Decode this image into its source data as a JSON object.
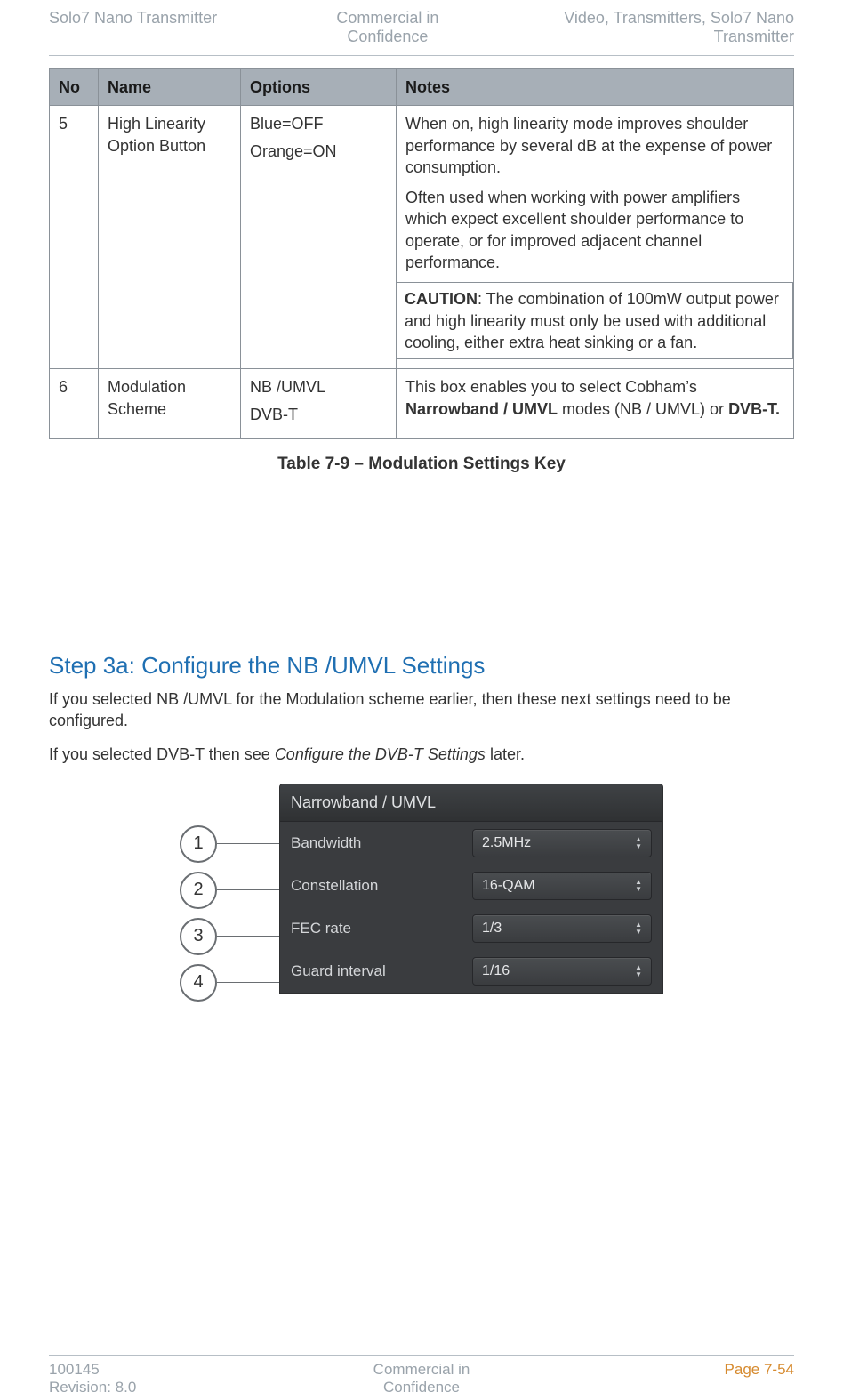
{
  "header": {
    "left": "Solo7 Nano Transmitter",
    "mid_line1": "Commercial in",
    "mid_line2": "Confidence",
    "right_line1": "Video, Transmitters, Solo7 Nano",
    "right_line2": "Transmitter"
  },
  "table": {
    "headers": {
      "no": "No",
      "name": "Name",
      "options": "Options",
      "notes": "Notes"
    },
    "row5": {
      "no": "5",
      "name": "High Linearity Option Button",
      "opt_blue": "Blue=OFF",
      "opt_orange": "Orange=ON",
      "note_p1": "When on, high linearity mode improves shoulder performance by several dB at the expense of power consumption.",
      "note_p2": "Often used when working with power amplifiers which expect excellent shoulder performance to operate, or for improved adjacent channel performance.",
      "caution_label": "CAUTION",
      "caution_rest": ": The combination of 100mW output power and high linearity must only be used with additional cooling, either extra heat sinking or a fan."
    },
    "row6": {
      "no": "6",
      "name": "Modulation Scheme",
      "opt1": "NB /UMVL",
      "opt2": "DVB-T",
      "note_pre": "This box enables you to select Cobham’s ",
      "note_b1": "Narrowband / UMVL",
      "note_mid": " modes (NB / UMVL) or ",
      "note_b2": "DVB-T.",
      "note_post": ""
    },
    "caption": "Table 7-9 – Modulation Settings Key"
  },
  "step": {
    "title": "Step 3a: Configure the NB /UMVL Settings",
    "p1": "If you selected NB /UMVL for the Modulation scheme earlier, then these next settings need to be configured.",
    "p2_pre": "If you selected DVB-T then see ",
    "p2_ital": "Configure the DVB-T Settings",
    "p2_post": " later."
  },
  "panel": {
    "title": "Narrowband / UMVL",
    "rows": [
      {
        "label": "Bandwidth",
        "value": "2.5MHz"
      },
      {
        "label": "Constellation",
        "value": "16-QAM"
      },
      {
        "label": "FEC rate",
        "value": "1/3"
      },
      {
        "label": "Guard interval",
        "value": "1/16"
      }
    ],
    "callouts": [
      "1",
      "2",
      "3",
      "4"
    ]
  },
  "footer": {
    "left_line1": "100145",
    "left_line2": "Revision: 8.0",
    "mid_line1": "Commercial in",
    "mid_line2": "Confidence",
    "right": "Page 7-54"
  }
}
